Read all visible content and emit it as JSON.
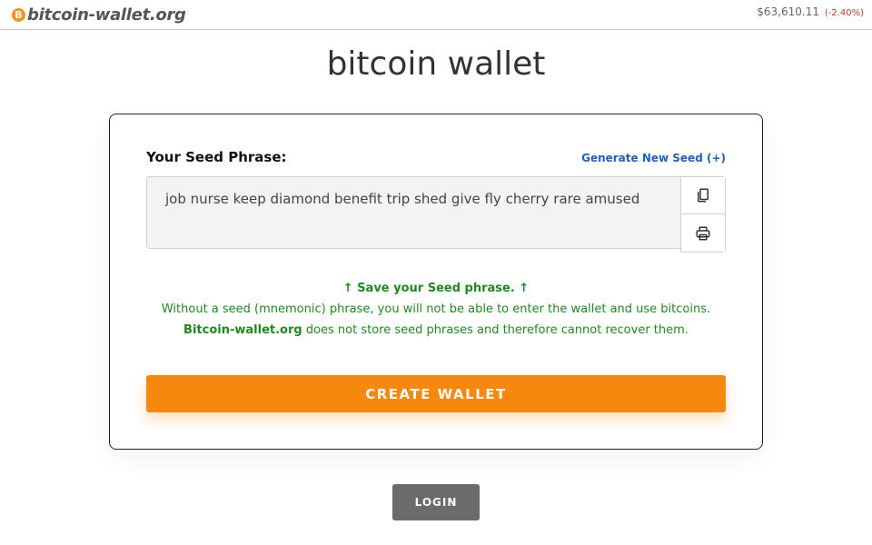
{
  "header": {
    "logo_coin": "B",
    "logo_text": "bitcoin-wallet.org",
    "price": "$63,610.11",
    "change": "(-2.40%)"
  },
  "main": {
    "title": "bitcoin wallet"
  },
  "card": {
    "seed_label": "Your Seed Phrase:",
    "generate_link": "Generate New Seed (+)",
    "seed_phrase": "job nurse keep diamond benefit trip shed give fly cherry rare amused",
    "copy_icon": "copy-icon",
    "print_icon": "printer-icon",
    "notice_title": "↑ Save your Seed phrase. ↑",
    "notice_line1": "Without a seed (mnemonic) phrase, you will not be able to enter the wallet and use bitcoins.",
    "notice_brand": "Bitcoin-wallet.org",
    "notice_line2": " does not store seed phrases and therefore cannot recover them.",
    "create_button": "CREATE WALLET"
  },
  "footer": {
    "login_button": "LOGIN"
  },
  "colors": {
    "accent_orange": "#f7880e",
    "link_blue": "#1f5fbf",
    "notice_green": "#1e8a1e",
    "login_gray": "#6b6b6b"
  }
}
